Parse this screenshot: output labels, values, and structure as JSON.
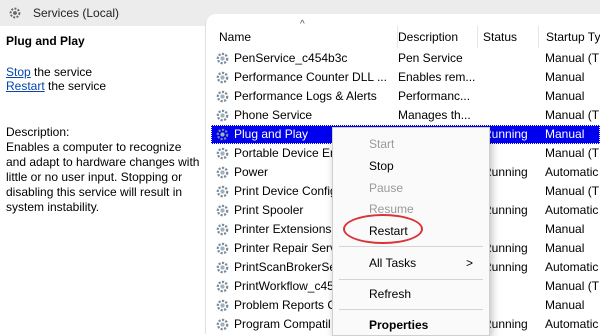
{
  "window": {
    "title": "Services (Local)"
  },
  "left_pane": {
    "heading": "Plug and Play",
    "stop_link": "Stop",
    "stop_rest": " the service",
    "restart_link": "Restart",
    "restart_rest": " the service",
    "description_label": "Description:",
    "description": "Enables a computer to recognize and adapt to hardware changes with little or no user input. Stopping or disabling this service will result in system instability."
  },
  "columns": [
    "Name",
    "Description",
    "Status",
    "Startup Ty"
  ],
  "sort_indicator": "^",
  "rows": [
    {
      "name": "PenService_c454b3c",
      "description": "Pen Service",
      "status": "",
      "startup": "Manual (T"
    },
    {
      "name": "Performance Counter DLL ...",
      "description": "Enables rem...",
      "status": "",
      "startup": "Manual"
    },
    {
      "name": "Performance Logs & Alerts",
      "description": "Performanc...",
      "status": "",
      "startup": "Manual"
    },
    {
      "name": "Phone Service",
      "description": "Manages th...",
      "status": "",
      "startup": "Manual (T"
    },
    {
      "name": "Plug and Play",
      "description": "",
      "status": "Running",
      "startup": "Manual"
    },
    {
      "name": "Portable Device En",
      "description": "",
      "status": "",
      "startup": "Manual (T"
    },
    {
      "name": "Power",
      "description": "",
      "status": "Running",
      "startup": "Automatic"
    },
    {
      "name": "Print Device Config",
      "description": "",
      "status": "",
      "startup": "Manual (T"
    },
    {
      "name": "Print Spooler",
      "description": "",
      "status": "Running",
      "startup": "Automatic"
    },
    {
      "name": "Printer Extensions",
      "description": "",
      "status": "",
      "startup": "Manual"
    },
    {
      "name": "Printer Repair Serv",
      "description": "",
      "status": "Running",
      "startup": "Manual"
    },
    {
      "name": "PrintScanBrokerSe",
      "description": "",
      "status": "Running",
      "startup": "Automatic"
    },
    {
      "name": "PrintWorkflow_c45",
      "description": "",
      "status": "",
      "startup": "Manual (T"
    },
    {
      "name": "Problem Reports C",
      "description": "",
      "status": "",
      "startup": "Manual"
    },
    {
      "name": "Program Compatil",
      "description": "",
      "status": "Running",
      "startup": "Automatic"
    }
  ],
  "selected_row": "Plug and Play",
  "context_menu": {
    "start": "Start",
    "stop": "Stop",
    "pause": "Pause",
    "resume": "Resume",
    "restart": "Restart",
    "all_tasks": "All Tasks",
    "all_tasks_arrow": ">",
    "refresh": "Refresh",
    "properties": "Properties"
  },
  "colors": {
    "selection": "#0000ee",
    "annotation_ring": "#d9343a",
    "link": "#0645ad"
  },
  "icons": {
    "title": "gear-icon",
    "service": "gear-icon",
    "submenu": "chevron-right-icon"
  }
}
